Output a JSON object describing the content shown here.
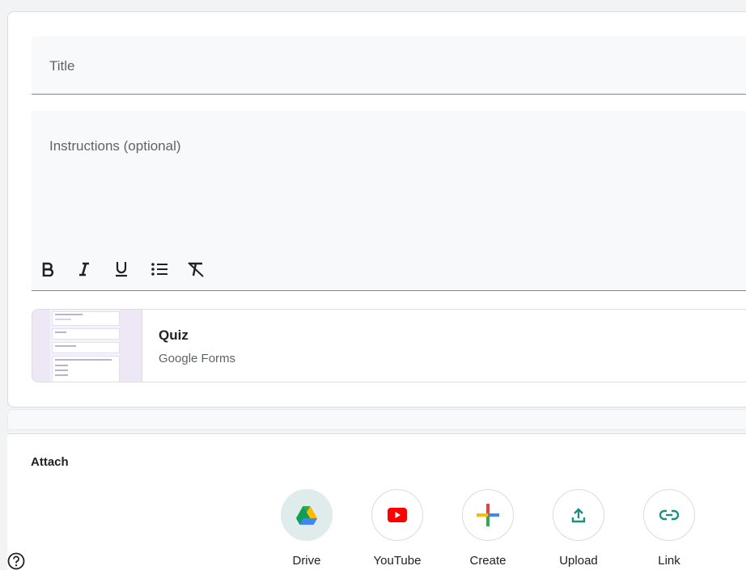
{
  "form": {
    "title_placeholder": "Title",
    "instructions_placeholder": "Instructions (optional)",
    "toolbar": [
      {
        "name": "bold",
        "icon": "bold-icon"
      },
      {
        "name": "italic",
        "icon": "italic-icon"
      },
      {
        "name": "underline",
        "icon": "underline-icon"
      },
      {
        "name": "bulleted-list",
        "icon": "bulleted-list-icon"
      },
      {
        "name": "clear-formatting",
        "icon": "clear-formatting-icon"
      }
    ]
  },
  "attachment": {
    "title": "Quiz",
    "subtitle": "Google Forms",
    "thumbnail_icon": "google-forms-thumbnail"
  },
  "attach": {
    "label": "Attach",
    "buttons": [
      {
        "label": "Drive",
        "icon": "google-drive-icon"
      },
      {
        "label": "YouTube",
        "icon": "youtube-icon"
      },
      {
        "label": "Create",
        "icon": "plus-icon"
      },
      {
        "label": "Upload",
        "icon": "upload-icon"
      },
      {
        "label": "Link",
        "icon": "link-icon"
      }
    ]
  },
  "help": {
    "icon": "help-icon"
  },
  "colors": {
    "text_primary": "#202124",
    "text_secondary": "#5f6368",
    "field_bg": "#f8f9fa",
    "drive_active_bg": "#e0ebeb",
    "youtube_red": "#ff0000",
    "upload_teal": "#1e8e7e",
    "link_teal": "#1e8e7e"
  }
}
